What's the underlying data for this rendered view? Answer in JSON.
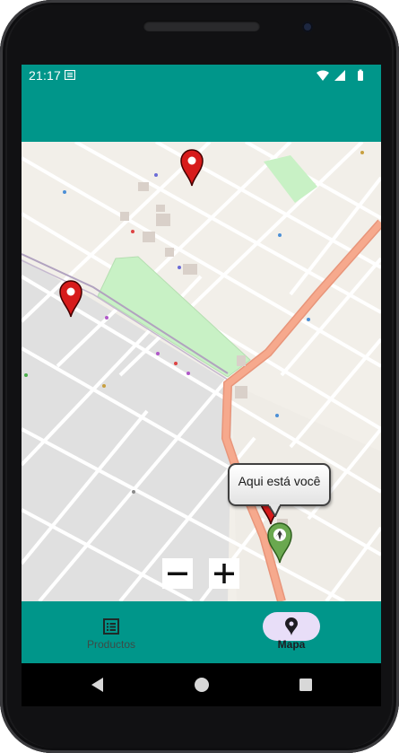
{
  "status_bar": {
    "time": "21:17",
    "icons": [
      "notification-icon",
      "wifi-icon",
      "signal-icon",
      "battery-icon"
    ]
  },
  "map": {
    "street_label": "",
    "markers": [
      {
        "name": "red-location-pin",
        "color": "#d71b1b"
      },
      {
        "name": "red-location-pin",
        "color": "#d71b1b"
      },
      {
        "name": "current-location-pin",
        "color": "#6aa84f"
      }
    ],
    "callout": {
      "text": "Aqui está você"
    },
    "zoom_controls": {
      "zoom_out": "−",
      "zoom_in": "+"
    }
  },
  "bottom_nav": {
    "items": [
      {
        "label": "Productos",
        "icon": "list-icon",
        "active": false
      },
      {
        "label": "Mapa",
        "icon": "location-pin-icon",
        "active": true
      }
    ]
  },
  "colors": {
    "primary": "#00968a",
    "active_indicator": "#e8def8",
    "map_background": "#f2efe9",
    "park": "#c8f1c5",
    "main_road": "#f6a98d"
  }
}
